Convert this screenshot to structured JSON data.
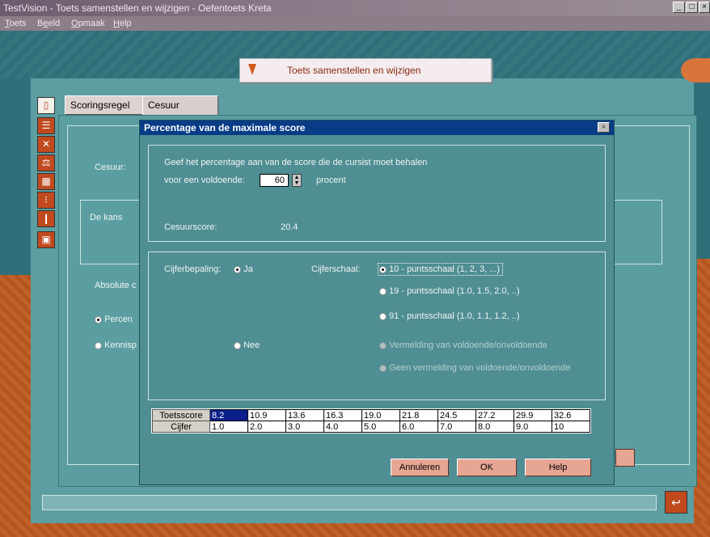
{
  "window": {
    "title": "TestVision - Toets samenstellen en wijzigen - Oefentoets Kreta",
    "controls": [
      "minimize-icon",
      "maximize-icon",
      "close-icon"
    ]
  },
  "menu": [
    {
      "pre": "",
      "u": "T",
      "post": "oets"
    },
    {
      "pre": "B",
      "u": "e",
      "post": "eld"
    },
    {
      "pre": "",
      "u": "O",
      "post": "pmaak"
    },
    {
      "pre": "",
      "u": "H",
      "post": "elp"
    }
  ],
  "header": {
    "title": "Toets samenstellen en wijzigen"
  },
  "toolbar_icons": [
    "document-icon",
    "checklist-icon",
    "tools-icon",
    "scales-icon",
    "calculator-icon",
    "traffic-light-icon",
    "thermometer-icon",
    "save-icon"
  ],
  "tabs": [
    {
      "label": "Scoringsregel"
    },
    {
      "label": "Cesuur"
    }
  ],
  "background_panel": {
    "cesuur_label": "Cesuur:",
    "kans_label": "De kans",
    "absolute_label": "Absolute c",
    "radio_percent": "Percen",
    "radio_kennis": "Kennisp"
  },
  "dialog": {
    "title": "Percentage van de maximale score",
    "instruction_line1": "Geef het percentage aan van de score die de cursist moet behalen",
    "instruction_line2": "voor een voldoende:",
    "percentage_value": "60",
    "percentage_unit": "procent",
    "cesuurscore_label": "Cesuurscore:",
    "cesuurscore_value": "20.4",
    "cijferbepaling_label": "Cijferbepaling:",
    "ja_label": "Ja",
    "nee_label": "Nee",
    "cijferschaal_label": "Cijferschaal:",
    "scale_options": [
      "10 - puntsschaal (1, 2, 3, ...)",
      "19 - puntsschaal (1.0, 1.5, 2.0, ..)",
      "91 - puntsschaal (1.0, 1.1, 1.2, ..)",
      "Vermelding van voldoende/onvoldoende",
      "Geen vermelding van voldoende/onvoldoende"
    ],
    "table": {
      "row1_header": "Toetsscore",
      "row1": [
        "8.2",
        "10.9",
        "13.6",
        "16.3",
        "19.0",
        "21.8",
        "24.5",
        "27.2",
        "29.9",
        "32.6"
      ],
      "row2_header": "Cijfer",
      "row2": [
        "1.0",
        "2.0",
        "3.0",
        "4.0",
        "5.0",
        "6.0",
        "7.0",
        "8.0",
        "9.0",
        "10"
      ]
    },
    "buttons": {
      "cancel": "Annuleren",
      "ok": "OK",
      "help": "Help"
    }
  }
}
